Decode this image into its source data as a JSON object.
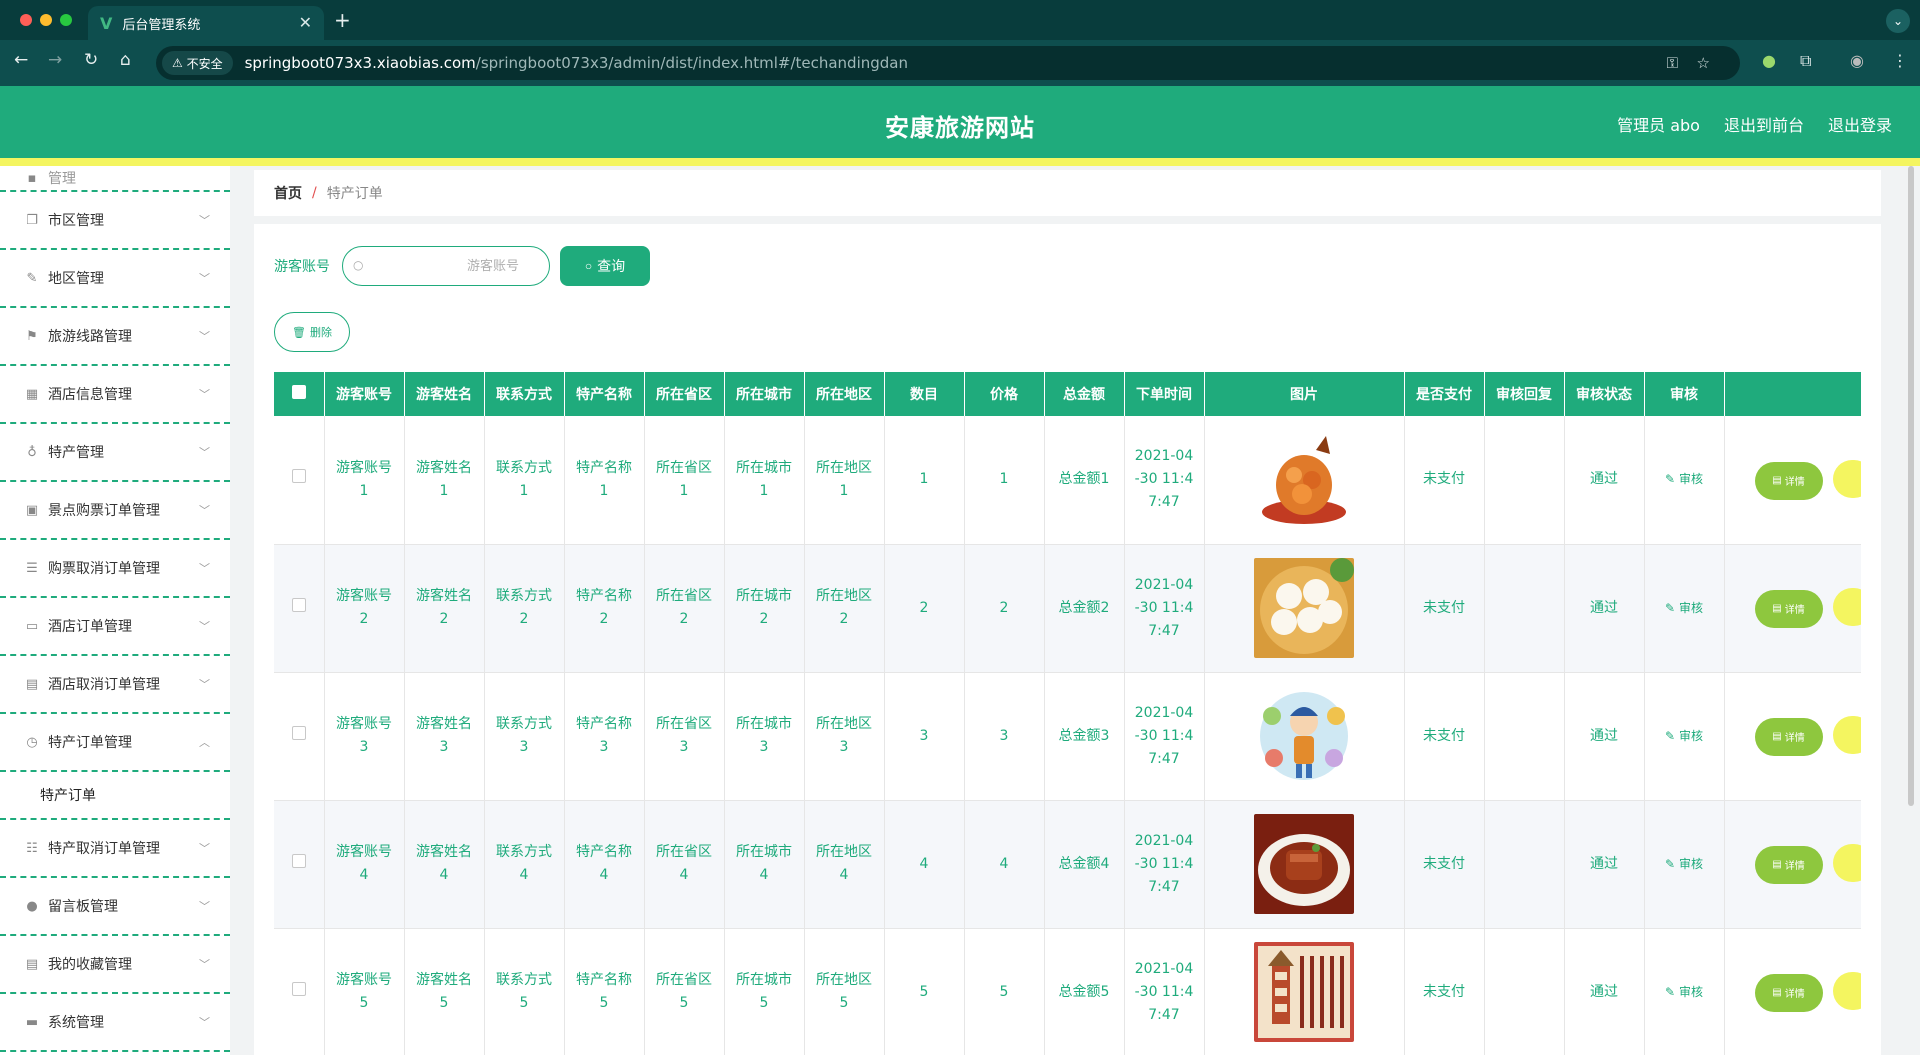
{
  "browser": {
    "tab_title": "后台管理系统",
    "insecure_label": "不安全",
    "url_host": "springboot073x3.xiaobias.com",
    "url_path": "/springboot073x3/admin/dist/index.html#/techandingdan"
  },
  "header": {
    "title": "安康旅游网站",
    "admin_label": "管理员 abo",
    "to_front_label": "退出到前台",
    "logout_label": "退出登录"
  },
  "sidebar": {
    "partial_label": "管理",
    "items": [
      {
        "label": "市区管理",
        "icon": "copy-icon"
      },
      {
        "label": "地区管理",
        "icon": "bell-off-icon"
      },
      {
        "label": "旅游线路管理",
        "icon": "flag-icon"
      },
      {
        "label": "酒店信息管理",
        "icon": "grid-icon"
      },
      {
        "label": "特产管理",
        "icon": "microphone-icon"
      },
      {
        "label": "景点购票订单管理",
        "icon": "clipboard-x-icon"
      },
      {
        "label": "购票取消订单管理",
        "icon": "list-icon"
      },
      {
        "label": "酒店订单管理",
        "icon": "monitor-icon"
      },
      {
        "label": "酒店取消订单管理",
        "icon": "printer-icon"
      },
      {
        "label": "特产订单管理",
        "icon": "clock-icon"
      }
    ],
    "sub_item": "特产订单",
    "items_after": [
      {
        "label": "特产取消订单管理",
        "icon": "sliders-icon"
      },
      {
        "label": "留言板管理",
        "icon": "lightbulb-icon"
      },
      {
        "label": "我的收藏管理",
        "icon": "document-icon"
      },
      {
        "label": "系统管理",
        "icon": "ticket-icon"
      }
    ]
  },
  "breadcrumb": {
    "home": "首页",
    "separator": "/",
    "current": "特产订单"
  },
  "search": {
    "label": "游客账号",
    "placeholder": "游客账号",
    "query_label": "查询"
  },
  "toolbar": {
    "delete_label": "删除"
  },
  "table": {
    "headers": [
      "游客账号",
      "游客姓名",
      "联系方式",
      "特产名称",
      "所在省区",
      "所在城市",
      "所在地区",
      "数目",
      "价格",
      "总金额",
      "下单时间",
      "图片",
      "是否支付",
      "审核回复",
      "审核状态",
      "审核"
    ],
    "rows": [
      {
        "account": "游客账号1",
        "name": "游客姓名1",
        "contact": "联系方式1",
        "product": "特产名称1",
        "province": "所在省区1",
        "city": "所在城市1",
        "district": "所在地区1",
        "count": "1",
        "price": "1",
        "total": "总金额1",
        "time": "2021-04-30 11:47:47",
        "paid": "未支付",
        "reply": "",
        "status": "通过",
        "audit": "审核",
        "detail": "详情"
      },
      {
        "account": "游客账号2",
        "name": "游客姓名2",
        "contact": "联系方式2",
        "product": "特产名称2",
        "province": "所在省区2",
        "city": "所在城市2",
        "district": "所在地区2",
        "count": "2",
        "price": "2",
        "total": "总金额2",
        "time": "2021-04-30 11:47:47",
        "paid": "未支付",
        "reply": "",
        "status": "通过",
        "audit": "审核",
        "detail": "详情"
      },
      {
        "account": "游客账号3",
        "name": "游客姓名3",
        "contact": "联系方式3",
        "product": "特产名称3",
        "province": "所在省区3",
        "city": "所在城市3",
        "district": "所在地区3",
        "count": "3",
        "price": "3",
        "total": "总金额3",
        "time": "2021-04-30 11:47:47",
        "paid": "未支付",
        "reply": "",
        "status": "通过",
        "audit": "审核",
        "detail": "详情"
      },
      {
        "account": "游客账号4",
        "name": "游客姓名4",
        "contact": "联系方式4",
        "product": "特产名称4",
        "province": "所在省区4",
        "city": "所在城市4",
        "district": "所在地区4",
        "count": "4",
        "price": "4",
        "total": "总金额4",
        "time": "2021-04-30 11:47:47",
        "paid": "未支付",
        "reply": "",
        "status": "通过",
        "audit": "审核",
        "detail": "详情"
      },
      {
        "account": "游客账号5",
        "name": "游客姓名5",
        "contact": "联系方式5",
        "product": "特产名称5",
        "province": "所在省区5",
        "city": "所在城市5",
        "district": "所在地区5",
        "count": "5",
        "price": "5",
        "total": "总金额5",
        "time": "2021-04-30 11:47:47",
        "paid": "未支付",
        "reply": "",
        "status": "通过",
        "audit": "审核",
        "detail": "详情"
      }
    ]
  },
  "colors": {
    "primary": "#1fab7c",
    "accent_yellow": "#f4f560",
    "detail_green": "#8ec73e"
  }
}
